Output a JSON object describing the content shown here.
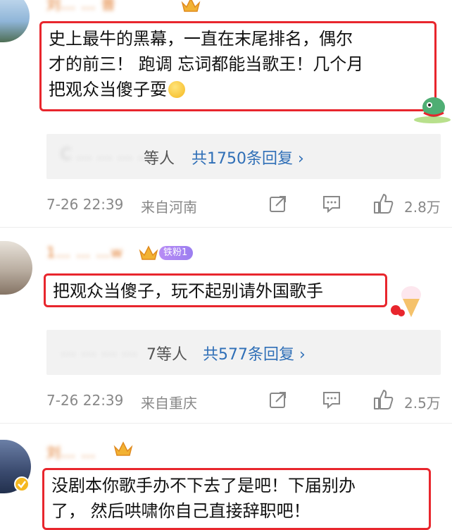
{
  "comments": [
    {
      "username": "刘… … 普",
      "content_lines": [
        "史上最牛的黑幕，一直在末尾排名，偶尔",
        "才的前三！ 跑调 忘词都能当歌王！几个月",
        "把观众当傻子耍"
      ],
      "reply_names": "C … … … …",
      "reply_suffix": "等人",
      "reply_count_text": "共1750条回复 ›",
      "time": "7-26 22:39",
      "location": "来自河南",
      "like_count": "2.8万"
    },
    {
      "username": "1… … …w",
      "fan_badge": "铁粉1",
      "content_lines": [
        "把观众当傻子，玩不起别请外国歌手"
      ],
      "reply_names": "… … … …",
      "reply_suffix": "7等人",
      "reply_count_text": "共577条回复 ›",
      "time": "7-26 22:39",
      "location": "来自重庆",
      "like_count": "2.5万"
    },
    {
      "username": "刘… …",
      "content_lines": [
        "没剧本你歌手办不下去了是吧！下届别办",
        "了， 然后哄啸你自己直接辞职吧！"
      ]
    }
  ],
  "colors": {
    "highlight_border": "#e8262d",
    "link": "#2f6fb7",
    "username": "#e0792a",
    "meta": "#888888"
  },
  "icons": {
    "share": "share-icon",
    "comment": "comment-icon",
    "like": "like-icon",
    "crown": "crown-icon"
  }
}
